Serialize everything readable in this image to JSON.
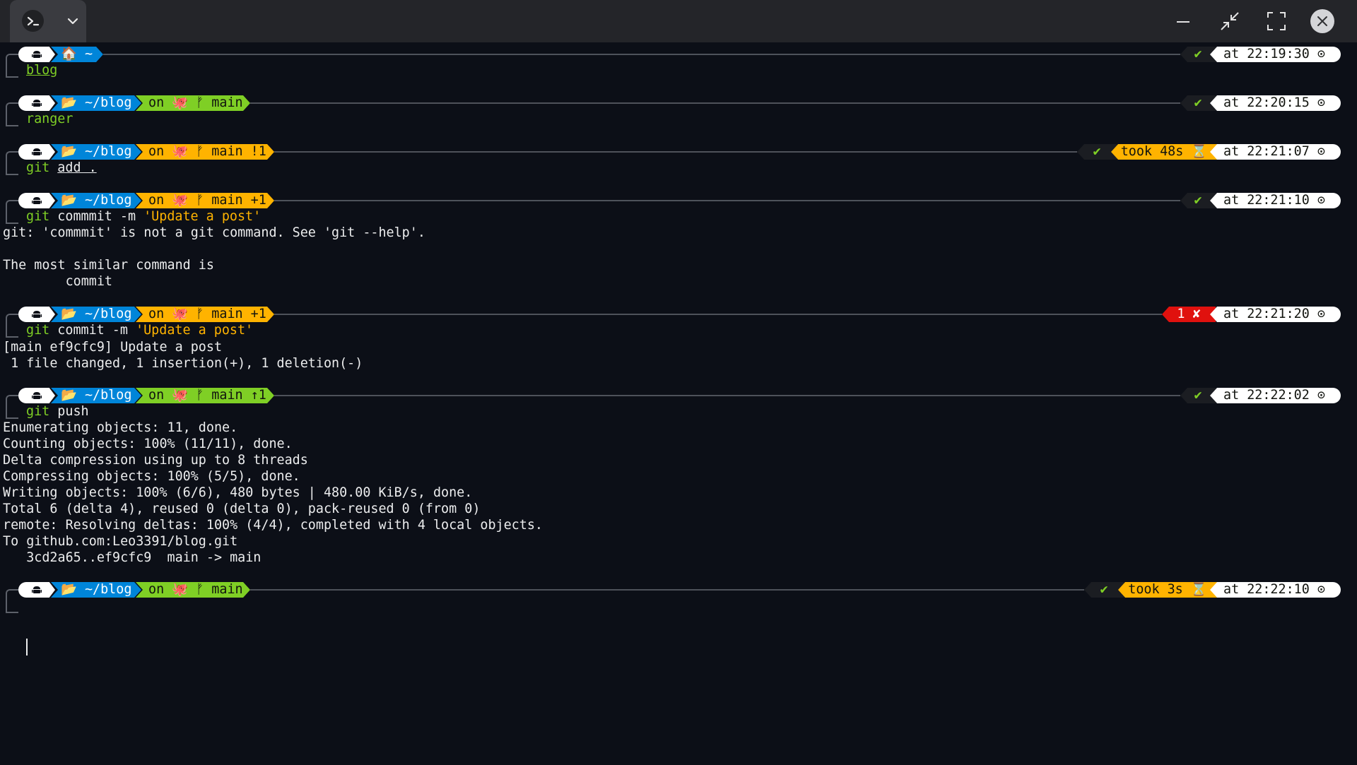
{
  "titlebar": {
    "icons": {
      "terminal": "terminal-prompt-icon",
      "dropdown": "chevron-down-icon",
      "minimize": "minimize-icon",
      "restore": "restore-down-icon",
      "fullscreen": "fullscreen-icon",
      "close": "close-icon"
    }
  },
  "colors": {
    "background": "#0c0f17",
    "path_segment": "#0085d9",
    "git_clean": "#7fcf25",
    "git_dirty": "#ffb300",
    "error": "#e0110e"
  },
  "prompts": [
    {
      "os_icon": "android-icon",
      "path": "🏠 ~",
      "git": "",
      "git_state": "",
      "status": "✔",
      "took": "",
      "time": "at 22:19:30 ⊙",
      "command": {
        "cmd": "blog",
        "args": "",
        "str": ""
      }
    },
    {
      "os_icon": "android-icon",
      "path": "📂 ~/blog",
      "git": "on 🐙 ᚠ main",
      "git_state": "clean",
      "status": "✔",
      "took": "",
      "time": "at 22:20:15 ⊙",
      "command": {
        "cmd": "ranger",
        "args": "",
        "str": ""
      }
    },
    {
      "os_icon": "android-icon",
      "path": "📂 ~/blog",
      "git": "on 🐙 ᚠ main !1",
      "git_state": "dirty",
      "status": "✔",
      "took": "took 48s ⌛",
      "time": "at 22:21:07 ⊙",
      "command": {
        "cmd": "git",
        "args": "add .",
        "str": ""
      }
    },
    {
      "os_icon": "android-icon",
      "path": "📂 ~/blog",
      "git": "on 🐙 ᚠ main +1",
      "git_state": "dirty",
      "status": "✔",
      "took": "",
      "time": "at 22:21:10 ⊙",
      "command": {
        "cmd": "git",
        "args": "commmit -m",
        "str": "'Update a post'"
      }
    },
    {
      "os_icon": "android-icon",
      "path": "📂 ~/blog",
      "git": "on 🐙 ᚠ main +1",
      "git_state": "dirty",
      "status": "1 ✘",
      "took": "",
      "time": "at 22:21:20 ⊙",
      "command": {
        "cmd": "git",
        "args": "commit -m",
        "str": "'Update a post'"
      }
    },
    {
      "os_icon": "android-icon",
      "path": "📂 ~/blog",
      "git": "on 🐙 ᚠ main ↑1",
      "git_state": "clean",
      "status": "✔",
      "took": "",
      "time": "at 22:22:02 ⊙",
      "command": {
        "cmd": "git",
        "args": "push",
        "str": ""
      }
    },
    {
      "os_icon": "android-icon",
      "path": "📂 ~/blog",
      "git": "on 🐙 ᚠ main",
      "git_state": "clean",
      "status": "✔",
      "took": "took 3s ⌛",
      "time": "at 22:22:10 ⊙",
      "command": {
        "cmd": "",
        "args": "",
        "str": ""
      }
    }
  ],
  "outputs": {
    "commmit_error": [
      "git: 'commmit' is not a git command. See 'git --help'.",
      "",
      "The most similar command is",
      "        commit"
    ],
    "commit_result": [
      "[main ef9cfc9] Update a post",
      " 1 file changed, 1 insertion(+), 1 deletion(-)"
    ],
    "push_result": [
      "Enumerating objects: 11, done.",
      "Counting objects: 100% (11/11), done.",
      "Delta compression using up to 8 threads",
      "Compressing objects: 100% (5/5), done.",
      "Writing objects: 100% (6/6), 480 bytes | 480.00 KiB/s, done.",
      "Total 6 (delta 4), reused 0 (delta 0), pack-reused 0 (from 0)",
      "remote: Resolving deltas: 100% (4/4), completed with 4 local objects.",
      "To github.com:Leo3391/blog.git",
      "   3cd2a65..ef9cfc9  main -> main"
    ]
  }
}
